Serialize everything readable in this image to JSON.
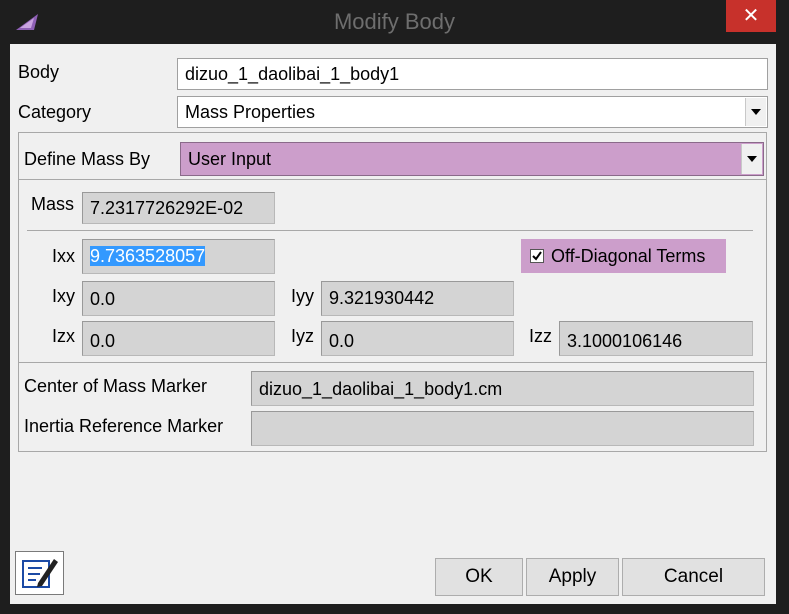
{
  "window": {
    "title": "Modify Body",
    "close_symbol": "✕"
  },
  "body_row": {
    "label": "Body",
    "value": "dizuo_1_daolibai_1_body1"
  },
  "category_row": {
    "label": "Category",
    "value": "Mass Properties"
  },
  "define_mass": {
    "label": "Define Mass By",
    "value": "User Input"
  },
  "mass": {
    "label": "Mass",
    "value": "7.2317726292E-02"
  },
  "inertia": {
    "ixx": {
      "label": "Ixx",
      "value": "9.7363528057"
    },
    "ixy": {
      "label": "Ixy",
      "value": "0.0"
    },
    "iyy": {
      "label": "Iyy",
      "value": "9.321930442"
    },
    "izx": {
      "label": "Izx",
      "value": "0.0"
    },
    "iyz": {
      "label": "Iyz",
      "value": "0.0"
    },
    "izz": {
      "label": "Izz",
      "value": "3.1000106146"
    }
  },
  "off_diagonal": {
    "label": "Off-Diagonal Terms",
    "checked": true
  },
  "cm_marker": {
    "label": "Center of Mass Marker",
    "value": "dizuo_1_daolibai_1_body1.cm"
  },
  "inertia_ref": {
    "label": "Inertia Reference Marker",
    "value": ""
  },
  "buttons": {
    "ok": "OK",
    "apply": "Apply",
    "cancel": "Cancel"
  },
  "colors": {
    "highlight": "#cc9ecb",
    "selection": "#3399ff",
    "close": "#c7312b"
  },
  "icons": {
    "app": "app-logo-icon",
    "notes": "notes-edit-icon"
  }
}
